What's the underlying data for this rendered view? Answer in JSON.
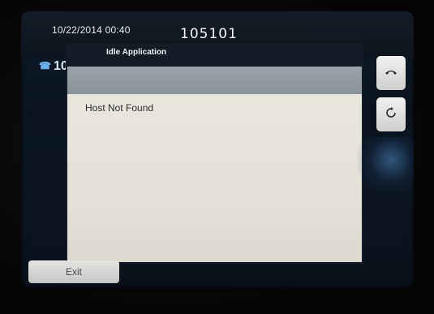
{
  "status_bar": {
    "datetime": "10/22/2014 00:40",
    "extension": "105101"
  },
  "line": {
    "icon": "phone-line-icon",
    "label": "10"
  },
  "dialog": {
    "title": "Idle Application",
    "message": "Host Not Found"
  },
  "softkeys": {
    "exit_label": "Exit"
  },
  "side_buttons": [
    {
      "icon": "hang-up-icon"
    },
    {
      "icon": "refresh-icon"
    }
  ],
  "colors": {
    "header_bar": "#8f979e",
    "dialog_body": "#e6e3da",
    "line_icon": "#6eb2ee"
  }
}
